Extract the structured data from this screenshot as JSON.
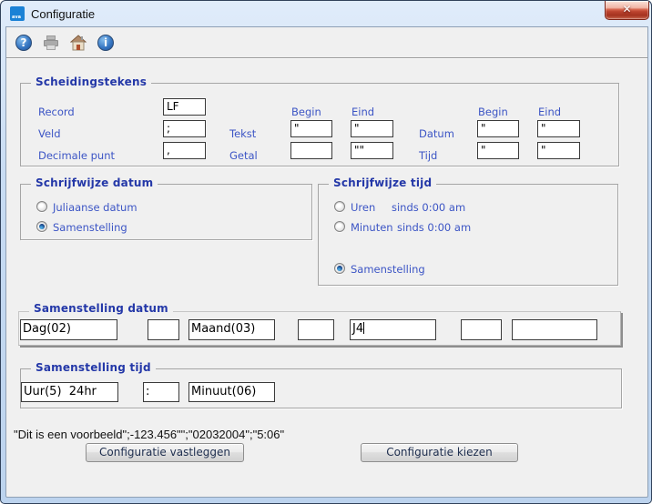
{
  "window": {
    "title": "Configuratie",
    "close_glyph": "✕"
  },
  "toolbar": {
    "help_glyph": "?",
    "info_glyph": "i",
    "icons": [
      "help-icon",
      "print-icon",
      "home-icon",
      "info-icon"
    ]
  },
  "scheidingstekens": {
    "title": "Scheidingstekens",
    "headers": {
      "begin1": "Begin",
      "eind1": "Eind",
      "begin2": "Begin",
      "eind2": "Eind"
    },
    "record": {
      "label": "Record",
      "value": "LF"
    },
    "veld": {
      "label": "Veld",
      "value": ";"
    },
    "decimale_punt": {
      "label": "Decimale punt",
      "value": ","
    },
    "tekst": {
      "label": "Tekst",
      "begin": "\"",
      "eind": "\""
    },
    "getal": {
      "label": "Getal",
      "begin": "",
      "eind": "\"\""
    },
    "datum": {
      "label": "Datum",
      "begin": "\"",
      "eind": "\""
    },
    "tijd": {
      "label": "Tijd",
      "begin": "\"",
      "eind": "\""
    }
  },
  "schrijfwijze_datum": {
    "title": "Schrijfwijze datum",
    "options": [
      {
        "label": "Juliaanse datum",
        "selected": false
      },
      {
        "label": "Samenstelling",
        "selected": true
      }
    ]
  },
  "schrijfwijze_tijd": {
    "title": "Schrijfwijze tijd",
    "options": [
      {
        "label": "Uren",
        "suffix": "sinds 0:00 am",
        "selected": false
      },
      {
        "label": "Minuten",
        "suffix": "sinds 0:00 am",
        "selected": false
      },
      {
        "label": "Samenstelling",
        "suffix": "",
        "selected": true
      }
    ]
  },
  "samenstelling_datum": {
    "title": "Samenstelling datum",
    "fields": [
      "Dag(02)",
      "",
      "Maand(03)",
      "",
      "J4",
      "",
      ""
    ]
  },
  "samenstelling_tijd": {
    "title": "Samenstelling tijd",
    "fields": [
      "Uur(5)  24hr",
      ":",
      "Minuut(06)"
    ]
  },
  "preview_text": "\"Dit is een voorbeeld\";-123.456\"\";\"02032004\";\"5:06\"",
  "buttons": {
    "vastleggen": "Configuratie vastleggen",
    "kiezen": "Configuratie kiezen"
  },
  "colors": {
    "label_blue": "#3c55c5",
    "title_navy": "#2438a8",
    "frame_blue": "#bcd3ee",
    "accent_red": "#c14a35"
  }
}
